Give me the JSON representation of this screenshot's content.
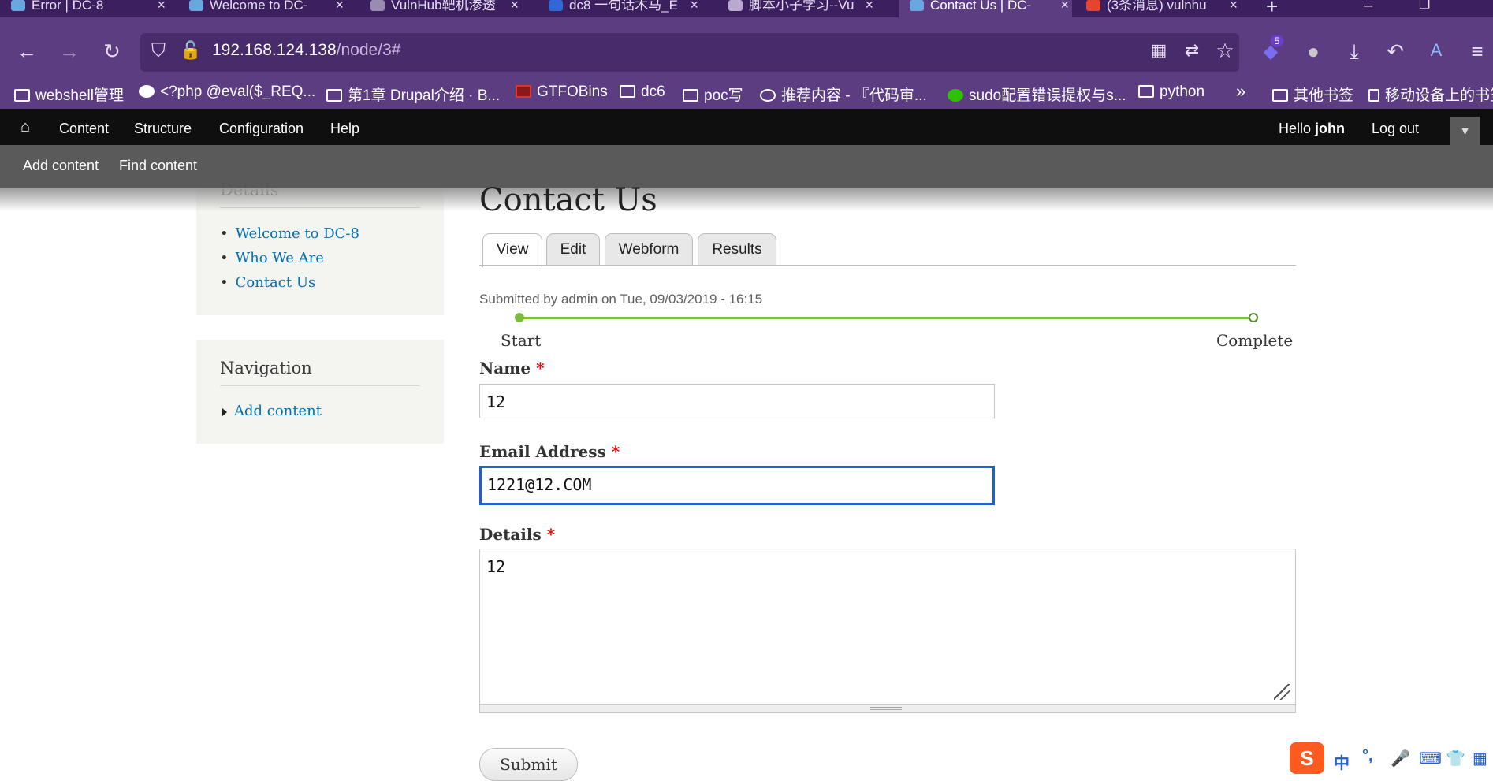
{
  "browser": {
    "tabs": [
      {
        "label": "Error | DC-8",
        "active": false
      },
      {
        "label": "Welcome to DC-",
        "active": false
      },
      {
        "label": "VulnHub靶机渗透",
        "active": false
      },
      {
        "label": "dc8 一句话木马_E",
        "active": false
      },
      {
        "label": "脚本小子学习--Vu",
        "active": false
      },
      {
        "label": "Contact Us | DC-",
        "active": true
      },
      {
        "label": "(3条消息) vulnhu",
        "active": false
      }
    ],
    "new_tab": "+",
    "url_host": "192.168.124.138",
    "url_path": "/node/3#",
    "extension_badge": "5",
    "bookmarks": [
      "webshell管理",
      "<?php @eval($_REQ...",
      "第1章 Drupal介绍 · B...",
      "GTFOBins",
      "dc6",
      "poc写",
      "推荐内容 - 『代码审...",
      "sudo配置错误提权与s...",
      "python",
      "其他书签",
      "移动设备上的书签"
    ],
    "bookmarks_more": "»"
  },
  "toolbar": {
    "items": [
      "Content",
      "Structure",
      "Configuration",
      "Help"
    ],
    "hello": "Hello",
    "user": "john",
    "logout": "Log out",
    "sub_items": [
      "Add content",
      "Find content"
    ]
  },
  "sidebar": {
    "details_title": "Details",
    "details_links": [
      "Welcome to DC-8",
      "Who We Are",
      "Contact Us"
    ],
    "nav_title": "Navigation",
    "nav_links": [
      "Add content"
    ]
  },
  "page": {
    "title": "Contact Us",
    "tabs": [
      "View",
      "Edit",
      "Webform",
      "Results"
    ],
    "submitted": "Submitted by admin on Tue, 09/03/2019 - 16:15",
    "progress": {
      "start": "Start",
      "end": "Complete",
      "fraction_complete": 0
    }
  },
  "form": {
    "name_label": "Name",
    "name_value": "12",
    "email_label": "Email Address",
    "email_value": "1221@12.COM",
    "details_label": "Details",
    "details_value": "12",
    "required_mark": "*",
    "submit_label": "Submit"
  },
  "ime": {
    "lang": "中",
    "punct": "°,"
  },
  "colors": {
    "browser_bg": "#5c3d82",
    "toolbar_bg": "#0f0f0f",
    "link": "#0071b3",
    "progress": "#7bbd3b",
    "focus": "#1f5fcf"
  }
}
